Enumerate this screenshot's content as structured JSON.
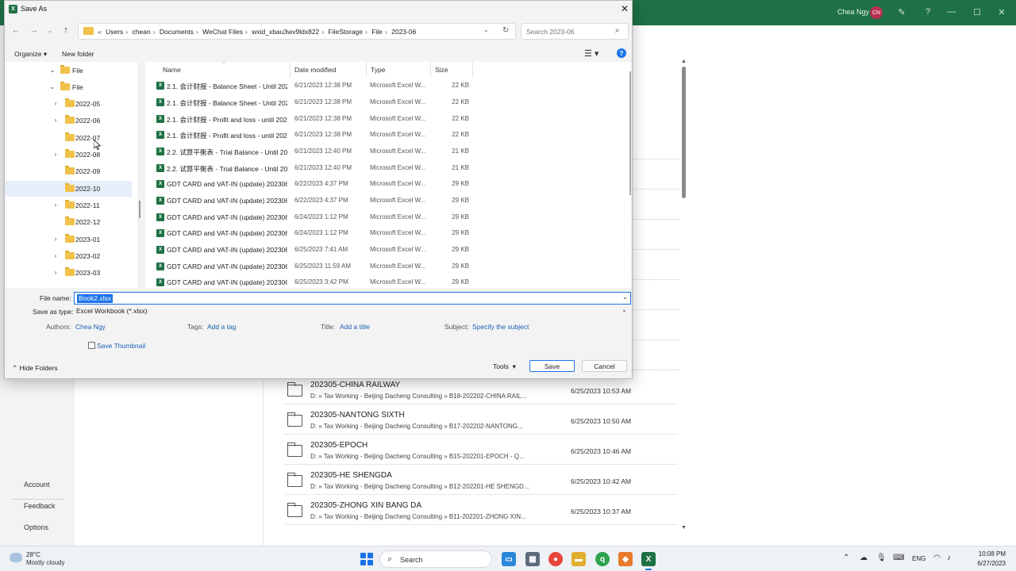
{
  "background": {
    "user_name": "Chea Ngy",
    "user_initials": "CN",
    "left_menu": [
      "Account",
      "Feedback",
      "Options"
    ],
    "recent": [
      {
        "name": "202305-CHINA RAILWAY",
        "path": "D: » Tax Working - Beijing Dacheng Consulting » B18-202202-CHINA RAIL...",
        "date": "6/25/2023 10:53 AM"
      },
      {
        "name": "202305-NANTONG SIXTH",
        "path": "D: » Tax Working - Beijing Dacheng Consulting » B17-202202-NANTONG...",
        "date": "6/25/2023 10:50 AM"
      },
      {
        "name": "202305-EPOCH",
        "path": "D: » Tax Working - Beijing Dacheng Consulting » B15-202201-EPOCH - Q...",
        "date": "6/25/2023 10:46 AM"
      },
      {
        "name": "202305-HE SHENGDA",
        "path": "D: » Tax Working - Beijing Dacheng Consulting » B12-202201-HE SHENGD...",
        "date": "6/25/2023 10:42 AM"
      },
      {
        "name": "202305-ZHONG XIN BANG DA",
        "path": "D: » Tax Working - Beijing Dacheng Consulting » B11-202201-ZHONG XIN...",
        "date": "6/25/2023 10:37 AM"
      }
    ]
  },
  "taskbar": {
    "temp": "28°C",
    "weather": "Mostly cloudy",
    "search_label": "Search",
    "lang": "ENG",
    "time": "10:08 PM",
    "date": "6/27/2023"
  },
  "dialog": {
    "title": "Save As",
    "breadcrumbs": [
      "Users",
      "chean",
      "Documents",
      "WeChat Files",
      "wxid_xbau3wv9ldx822",
      "FileStorage",
      "File",
      "2023-06"
    ],
    "search_placeholder": "Search 2023-06",
    "organize": "Organize",
    "new_folder": "New folder",
    "tree": [
      {
        "label": "File",
        "indent": 1,
        "expanded": true,
        "chev": true
      },
      {
        "label": "File",
        "indent": 2,
        "expanded": true,
        "chev": true
      },
      {
        "label": "2022-05",
        "indent": 3,
        "chev": true
      },
      {
        "label": "2022-06",
        "indent": 3,
        "chev": true
      },
      {
        "label": "2022-07",
        "indent": 3,
        "chev": false
      },
      {
        "label": "2022-08",
        "indent": 3,
        "chev": true
      },
      {
        "label": "2022-09",
        "indent": 3,
        "chev": false
      },
      {
        "label": "2022-10",
        "indent": 3,
        "chev": false,
        "selected": true
      },
      {
        "label": "2022-11",
        "indent": 3,
        "chev": true
      },
      {
        "label": "2022-12",
        "indent": 3,
        "chev": false
      },
      {
        "label": "2023-01",
        "indent": 3,
        "chev": true
      },
      {
        "label": "2023-02",
        "indent": 3,
        "chev": true
      },
      {
        "label": "2023-03",
        "indent": 3,
        "chev": true
      }
    ],
    "columns": {
      "name": "Name",
      "date": "Date modified",
      "type": "Type",
      "size": "Size"
    },
    "files": [
      {
        "name": "2.1. 会计财报 - Balance Sheet - Until 202...",
        "date": "6/21/2023 12:38 PM",
        "type": "Microsoft Excel W...",
        "size": "22 KB"
      },
      {
        "name": "2.1. 会计财报 - Balance Sheet - Until 202...",
        "date": "6/21/2023 12:38 PM",
        "type": "Microsoft Excel W...",
        "size": "22 KB"
      },
      {
        "name": "2.1. 会计财报 - Profit and loss - until 202...",
        "date": "6/21/2023 12:38 PM",
        "type": "Microsoft Excel W...",
        "size": "22 KB"
      },
      {
        "name": "2.1. 会计财报 - Profit and loss - until 202...",
        "date": "6/21/2023 12:38 PM",
        "type": "Microsoft Excel W...",
        "size": "22 KB"
      },
      {
        "name": "2.2. 试算平衡表 - Trial Balance - Until 202...",
        "date": "6/21/2023 12:40 PM",
        "type": "Microsoft Excel W...",
        "size": "21 KB"
      },
      {
        "name": "2.2. 试算平衡表 - Trial Balance - Until 202...",
        "date": "6/21/2023 12:40 PM",
        "type": "Microsoft Excel W...",
        "size": "21 KB"
      },
      {
        "name": "GDT CARD and VAT-IN (update) 20230622...",
        "date": "6/22/2023 4:37 PM",
        "type": "Microsoft Excel W...",
        "size": "29 KB"
      },
      {
        "name": "GDT CARD and VAT-IN (update) 20230622...",
        "date": "6/22/2023 4:37 PM",
        "type": "Microsoft Excel W...",
        "size": "29 KB"
      },
      {
        "name": "GDT CARD and VAT-IN (update) 20230624...",
        "date": "6/24/2023 1:12 PM",
        "type": "Microsoft Excel W...",
        "size": "29 KB"
      },
      {
        "name": "GDT CARD and VAT-IN (update) 20230624...",
        "date": "6/24/2023 1:12 PM",
        "type": "Microsoft Excel W...",
        "size": "29 KB"
      },
      {
        "name": "GDT CARD and VAT-IN (update) 20230625...",
        "date": "6/25/2023 7:41 AM",
        "type": "Microsoft Excel W...",
        "size": "29 KB"
      },
      {
        "name": "GDT CARD and VAT-IN (update) 20230625...",
        "date": "6/25/2023 11:59 AM",
        "type": "Microsoft Excel W...",
        "size": "29 KB"
      },
      {
        "name": "GDT CARD and VAT-IN (update) 20230625...",
        "date": "6/25/2023 3:42 PM",
        "type": "Microsoft Excel W...",
        "size": "29 KB"
      }
    ],
    "file_name_label": "File name:",
    "file_name_value": "Book2.xlsx",
    "save_type_label": "Save as type:",
    "save_type_value": "Excel Workbook (*.xlsx)",
    "authors_label": "Authors:",
    "authors_value": "Chea Ngy",
    "tags_label": "Tags:",
    "tags_value": "Add a tag",
    "title_label": "Title:",
    "title_value": "Add a title",
    "subject_label": "Subject:",
    "subject_value": "Specify the subject",
    "save_thumbnail": "Save Thumbnail",
    "hide_folders": "Hide Folders",
    "tools": "Tools",
    "save": "Save",
    "cancel": "Cancel"
  },
  "colors": {
    "excel_green": "#1e7145",
    "accent_blue": "#1a73e8",
    "folder_yellow": "#f1c24a"
  }
}
